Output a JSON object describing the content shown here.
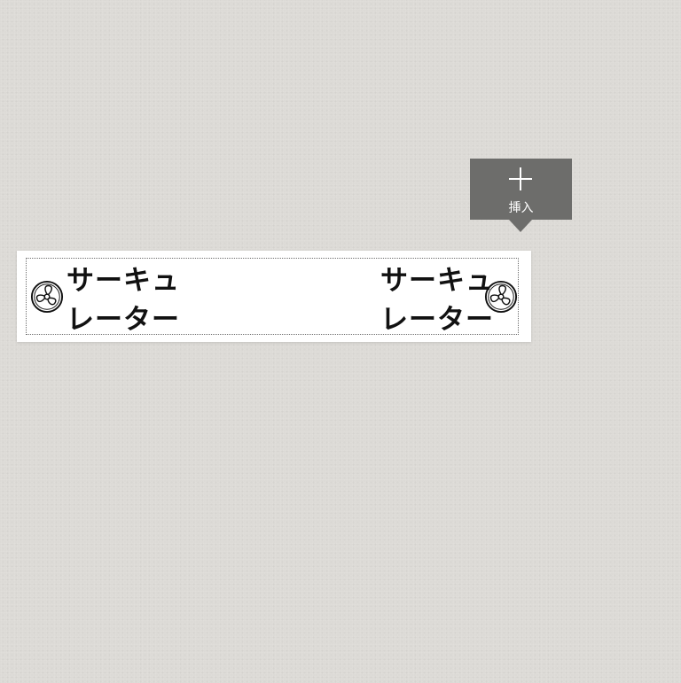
{
  "toolbar": {
    "insert_label": "挿入",
    "insert_icon": "plus-icon"
  },
  "labels": [
    {
      "line1": "サーキュ",
      "line2": "レーター",
      "icon": "fan-icon"
    },
    {
      "line1": "サーキュ",
      "line2": "レーター",
      "icon": "fan-icon"
    }
  ],
  "colors": {
    "background": "#dcdad6",
    "insert_button": "#6d6d6b",
    "sheet": "#ffffff",
    "text": "#111111"
  }
}
